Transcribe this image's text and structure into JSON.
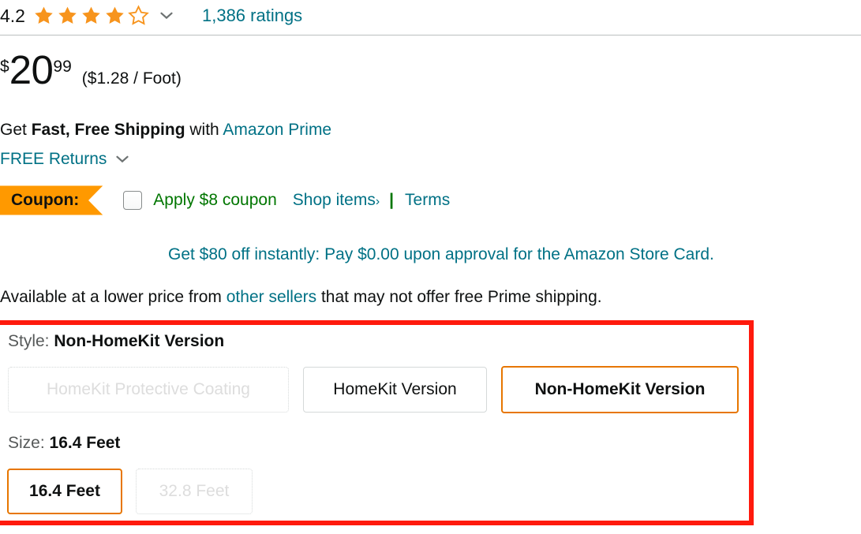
{
  "rating": {
    "value": "4.2",
    "stars_filled": 4,
    "stars_total": 5,
    "star_color": "#F7941D",
    "dropdown_icon": "chevron-down-icon",
    "ratings_count": "1,386 ratings"
  },
  "price": {
    "currency_symbol": "$",
    "whole": "20",
    "fraction": "99",
    "unit_price": "($1.28 / Foot)"
  },
  "shipping": {
    "prefix": "Get ",
    "emphasis": "Fast, Free Shipping",
    "middle": " with ",
    "prime_link": "Amazon Prime",
    "free_returns": "FREE Returns",
    "returns_icon": "chevron-down-icon"
  },
  "coupon": {
    "badge_label": "Coupon:",
    "badge_color": "#FF9900",
    "checkbox_checked": false,
    "apply_label": "Apply $8 coupon",
    "apply_color": "#007600",
    "shop_items_label": "Shop items",
    "shop_items_caret": "›",
    "separator": "|",
    "terms_label": "Terms"
  },
  "store_card": {
    "text": "Get $80 off instantly: Pay $0.00 upon approval for the Amazon Store Card.",
    "color": "#007185"
  },
  "other_sellers": {
    "prefix": "Available at a lower price from ",
    "link": "other sellers",
    "suffix": " that may not offer free Prime shipping."
  },
  "annotation": {
    "highlight_color": "#FF1A0D"
  },
  "twister": {
    "style": {
      "label_prefix": "Style: ",
      "selected_value": "Non-HomeKit Version",
      "options": [
        {
          "label": "HomeKit Protective Coating",
          "state": "disabled"
        },
        {
          "label": "HomeKit Version",
          "state": "normal"
        },
        {
          "label": "Non-HomeKit Version",
          "state": "selected"
        }
      ]
    },
    "size": {
      "label_prefix": "Size: ",
      "selected_value": "16.4 Feet",
      "options": [
        {
          "label": "16.4 Feet",
          "state": "selected"
        },
        {
          "label": "32.8 Feet",
          "state": "disabled"
        }
      ]
    },
    "selected_border_color": "#E77600"
  }
}
